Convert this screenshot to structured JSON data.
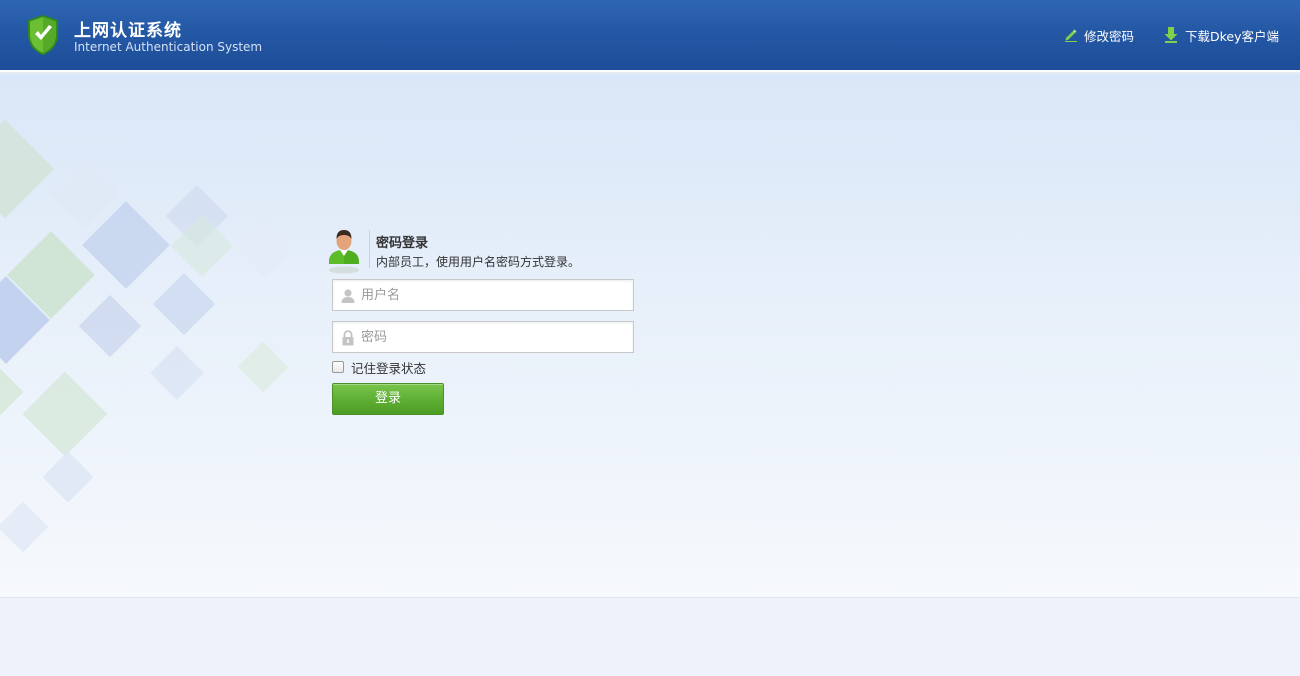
{
  "header": {
    "title": "上网认证系统",
    "subtitle": "Internet Authentication System",
    "change_password": "修改密码",
    "download_client": "下载Dkey客户端"
  },
  "login": {
    "title": "密码登录",
    "description": "内部员工，使用用户名密码方式登录。",
    "username_placeholder": "用户名",
    "password_placeholder": "密码",
    "remember_label": "记住登录状态",
    "submit_label": "登录"
  },
  "colors": {
    "header_blue": "#2458a5",
    "button_green": "#5eae33",
    "shield_green": "#5fae2e"
  },
  "icons": {
    "logo": "shield-check-icon",
    "change_password": "pencil-icon",
    "download": "download-arrow-icon",
    "avatar": "user-avatar-icon",
    "username": "user-icon",
    "password": "lock-icon"
  }
}
